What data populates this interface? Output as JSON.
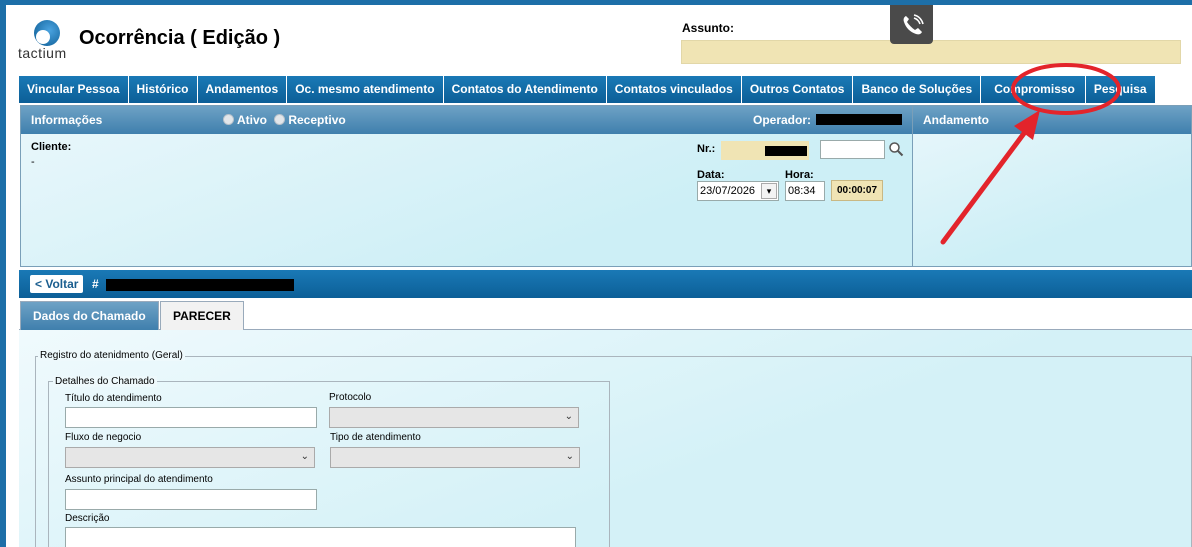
{
  "header": {
    "logo_text": "tactium",
    "title": "Ocorrência ( Edição )",
    "assunto_label": "Assunto:",
    "assunto_value": ""
  },
  "tabs": [
    {
      "label": "Vincular Pessoa"
    },
    {
      "label": "Histórico"
    },
    {
      "label": "Andamentos"
    },
    {
      "label": "Oc. mesmo atendimento"
    },
    {
      "label": "Contatos do Atendimento"
    },
    {
      "label": "Contatos vinculados"
    },
    {
      "label": "Outros Contatos"
    },
    {
      "label": "Banco de Soluções"
    },
    {
      "label": "Compromisso"
    },
    {
      "label": "Pesquisa"
    }
  ],
  "info": {
    "title": "Informações",
    "radio_ativo": "Ativo",
    "radio_receptivo": "Receptivo",
    "operador_label": "Operador:",
    "cliente_label": "Cliente:",
    "cliente_value": "-",
    "nr_label": "Nr.:",
    "data_label": "Data:",
    "data_value": "23/07/2026",
    "hora_label": "Hora:",
    "hora_value": "08:34",
    "timer_value": "00:00:07"
  },
  "andamento": {
    "title": "Andamento"
  },
  "crumb": {
    "back_label": "< Voltar",
    "ticket_prefix": "#"
  },
  "subtabs": {
    "active": "Dados do Chamado",
    "inactive": "PARECER"
  },
  "form": {
    "outer_legend": "Registro do atenidmento (Geral)",
    "inner_legend": "Detalhes do Chamado",
    "titulo_label": "Título do atendimento",
    "protocolo_label": "Protocolo",
    "fluxo_label": "Fluxo de negocio",
    "tipo_label": "Tipo de atendimento",
    "assunto_principal_label": "Assunto principal do atendimento",
    "descricao_label": "Descrição"
  },
  "colors": {
    "tab_blue": "#0c5f97",
    "panel_head": "#3f7fad",
    "highlight_yellow": "#f0e4b4",
    "annotation_red": "#e3242b"
  }
}
